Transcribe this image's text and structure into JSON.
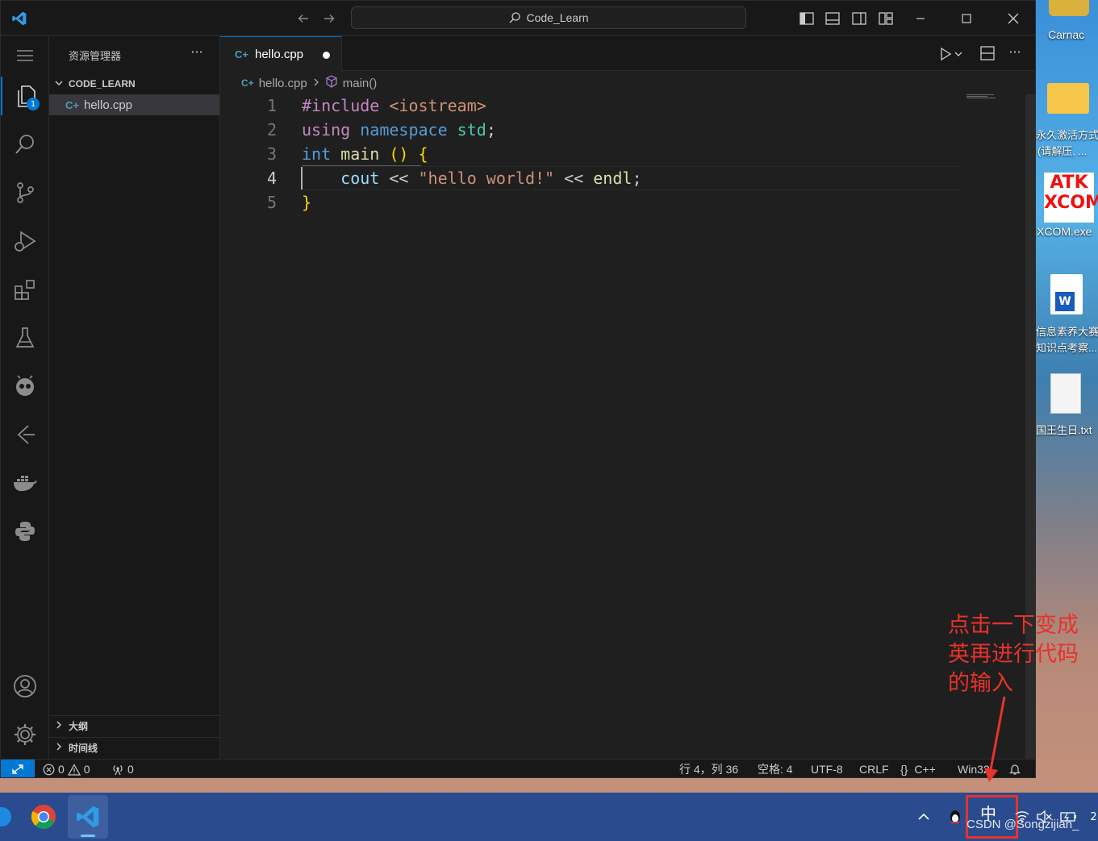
{
  "window": {
    "search_text": "Code_Learn"
  },
  "sidebar": {
    "title": "资源管理器",
    "more_icon": "ellipsis-icon",
    "folder_name": "CODE_LEARN",
    "file_name": "hello.cpp",
    "outline_label": "大纲",
    "timeline_label": "时间线",
    "explorer_badge": "1"
  },
  "editor": {
    "tab_label": "hello.cpp",
    "breadcrumb_file": "hello.cpp",
    "breadcrumb_symbol": "main()",
    "line_numbers": [
      "1",
      "2",
      "3",
      "4",
      "5"
    ],
    "code_tokens": {
      "l1_a": "#include",
      "l1_b": " <iostream>",
      "l2_a": "using",
      "l2_b": " namespace",
      "l2_c": " std",
      "l2_d": ";",
      "l3_a": "int",
      "l3_b": " main",
      "l3_c": " ()",
      "l3_d": " {",
      "l4_indent": "    ",
      "l4_a": "cout",
      "l4_b": " << ",
      "l4_c": "\"hello world!\"",
      "l4_d": " << ",
      "l4_e": "endl",
      "l4_f": ";",
      "l5_a": "}"
    }
  },
  "statusbar": {
    "errors": "0",
    "warnings": "0",
    "ports": "0",
    "position": "行 4，列 36",
    "spaces": "空格: 4",
    "encoding": "UTF-8",
    "eol": "CRLF",
    "language": "C++",
    "platform": "Win32"
  },
  "desktop": {
    "icons": [
      "Carnac",
      "永久激活方式",
      "(请解压, ...",
      "ATK",
      "XCOM",
      "XCOM.exe",
      "信息素养大赛",
      "知识点考察...",
      "国王生日.txt"
    ]
  },
  "annotation": {
    "line1": "点击一下变成",
    "line2": "英再进行代码",
    "line3": "的输入"
  },
  "taskbar": {
    "ime_label": "中",
    "watermark": "CSDN @Songzijian_",
    "clock_fragment": "2"
  },
  "colors": {
    "accent": "#0078d4",
    "annotation_red": "#e8322b"
  }
}
